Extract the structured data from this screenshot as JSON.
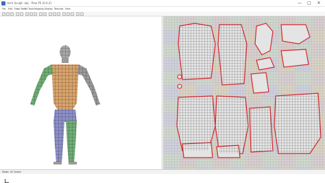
{
  "window": {
    "title": "Uvm Sculpt .obj - Prox P3 (0.4.2)",
    "controls": [
      "—",
      "□",
      "✕"
    ]
  },
  "menu": [
    "File",
    "Edit",
    "Edge Tools",
    "UV Tools",
    "Mapping",
    "Display",
    "Textures",
    "View"
  ],
  "status": {
    "mode_text": "Mode: UV Select"
  },
  "colors": {
    "seam": "#d6262a",
    "wire": "#333333"
  }
}
